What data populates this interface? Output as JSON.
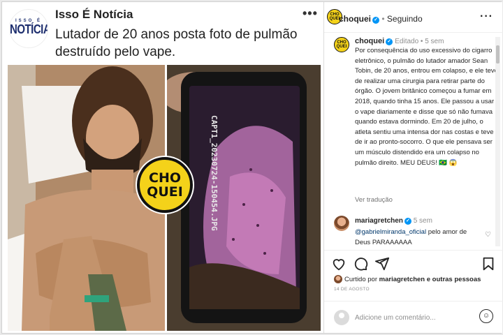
{
  "post": {
    "publisher_logo_small": "ISSO É",
    "publisher_logo_big": "NOTÍCIA",
    "publisher_name": "Isso É Notícia",
    "more_icon": "more-horizontal-icon",
    "headline": "Lutador de 20 anos posta foto de pulmão destruído pelo vape.",
    "photo_label": "CAPT1_20230724-150454.JPG",
    "stamp_line1": "CHO",
    "stamp_line2": "QUEI"
  },
  "panel": {
    "author": "choquei",
    "dot": "•",
    "follow_state": "Seguindo",
    "avatar_text": "CHO QUEI",
    "caption_meta": "Editado • 5 sem",
    "caption": "Por consequência do uso excessivo do cigarro eletrônico, o pulmão do lutador amador Sean Tobin, de 20 anos, entrou em colapso, e ele teve de realizar uma cirurgia para retirar parte do órgão. O jovem britânico começou a fumar em 2018, quando tinha 15 anos. Ele passou a usar o vape diariamente e disse que só não fumava quando estava dormindo. Em 20 de julho, o atleta sentiu uma intensa dor nas costas e teve de ir ao pronto-socorro. O que ele pensava ser um músculo distendido era um colapso no pulmão direito. MEU DEUS! 🇧🇷 😱",
    "see_translation": "Ver tradução",
    "comment": {
      "user": "mariagretchen",
      "time": "5 sem",
      "mention": "@gabrielmiranda_oficial",
      "text": " pelo amor de Deus PARAAAAAA"
    },
    "liked_by_prefix": "Curtido por ",
    "liked_by_user": "mariagretchen",
    "liked_by_suffix": " e outras pessoas",
    "date": "14 DE AGOSTO",
    "comment_placeholder": "Adicione um comentário...",
    "icons": [
      "heart-icon",
      "comment-icon",
      "share-icon",
      "bookmark-icon",
      "emoji-icon"
    ]
  },
  "colors": {
    "accent_blue": "#0095f6",
    "choquei_yellow": "#f4d21a",
    "publisher_navy": "#1d2e6e"
  }
}
